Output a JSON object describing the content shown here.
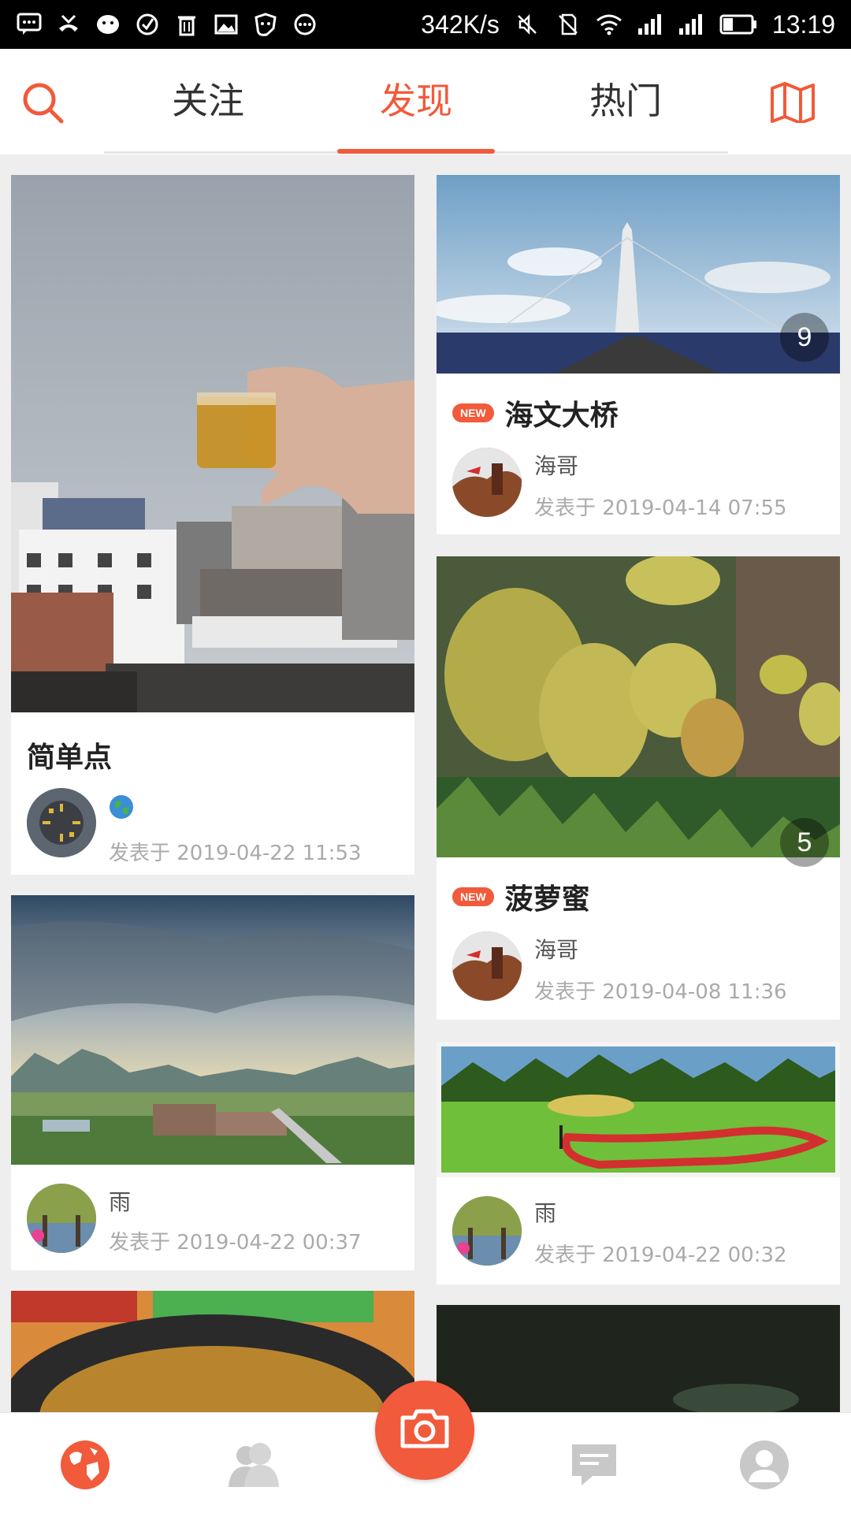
{
  "status_bar": {
    "speed": "342K/s",
    "time": "13:19",
    "icons": [
      "message-icon",
      "missed-call-icon",
      "wechat-icon",
      "check-icon",
      "trash-icon",
      "image-icon",
      "shield-icon",
      "more-icon",
      "mute-icon",
      "no-sim-icon",
      "wifi-icon",
      "signal-icon",
      "signal-icon",
      "battery-icon"
    ]
  },
  "topnav": {
    "tabs": [
      {
        "label": "关注"
      },
      {
        "label": "发现"
      },
      {
        "label": "热门"
      }
    ],
    "active_tab": "发现"
  },
  "cards": {
    "c1": {
      "title": "简单点",
      "date": "发表于   2019-04-22 11:53"
    },
    "c2": {
      "author": "雨",
      "date": "发表于   2019-04-22 00:37"
    },
    "r1": {
      "title": "海文大桥",
      "badge": "NEW",
      "author": "海哥",
      "date": "发表于   2019-04-14 07:55",
      "count": "9"
    },
    "r2": {
      "title": "菠萝蜜",
      "badge": "NEW",
      "author": "海哥",
      "date": "发表于   2019-04-08 11:36",
      "count": "5"
    },
    "r3": {
      "author": "雨",
      "date": "发表于   2019-04-22 00:32"
    }
  },
  "bottomnav": {
    "items": [
      "discover-globe-icon",
      "friends-icon",
      "camera-icon",
      "messages-icon",
      "profile-icon"
    ]
  },
  "colors": {
    "accent": "#f15a3a"
  }
}
